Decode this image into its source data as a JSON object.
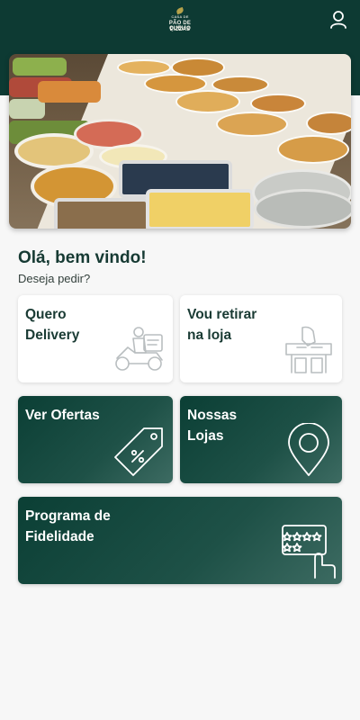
{
  "header": {
    "logo": {
      "line1": "CASA DE",
      "line2": "PÃO DE QUEIJO",
      "line3": "PIZZAS"
    },
    "profile_icon": "user-icon",
    "background_color": "#0d3a33"
  },
  "hero": {
    "image_icon": "food-buffet-photo"
  },
  "welcome": {
    "title": "Olá, bem vindo!",
    "subtitle": "Deseja pedir?"
  },
  "options": {
    "delivery": {
      "label": "Quero\nDelivery",
      "icon": "delivery-scooter-icon"
    },
    "pickup": {
      "label": "Vou retirar\nna loja",
      "icon": "store-pickup-icon"
    },
    "offers": {
      "label": "Ver Ofertas",
      "icon": "discount-tag-icon"
    },
    "stores": {
      "label": "Nossas\nLojas",
      "icon": "map-pin-icon"
    },
    "loyalty": {
      "label": "Programa de\nFidelidade",
      "icon": "loyalty-card-icon"
    }
  },
  "colors": {
    "brand_dark": "#0d3a33",
    "card_light": "#ffffff",
    "background": "#f7f7f7"
  }
}
